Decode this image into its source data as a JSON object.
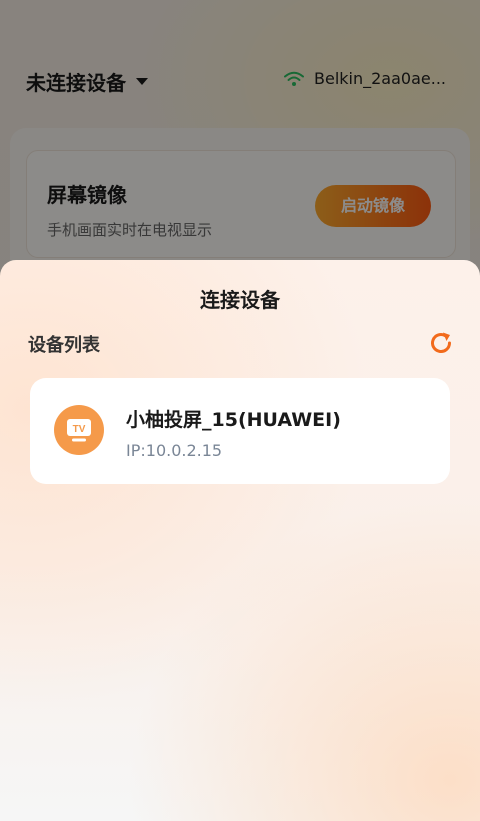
{
  "background": {
    "device_status": "未连接设备",
    "wifi_name": "Belkin_2aa0ae...",
    "mirror_card": {
      "title": "屏幕镜像",
      "subtitle": "手机画面实时在电视显示",
      "button_label": "启动镜像"
    }
  },
  "sheet": {
    "title": "连接设备",
    "list_header": "设备列表",
    "devices": [
      {
        "name": "小柚投屏_15(HUAWEI)",
        "ip": "IP:10.0.2.15",
        "icon": "tv-icon",
        "icon_label": "TV"
      }
    ]
  },
  "colors": {
    "accent": "#f26a1b",
    "tv_icon_bg": "#f59a4a",
    "ip_text": "#7a8696"
  }
}
